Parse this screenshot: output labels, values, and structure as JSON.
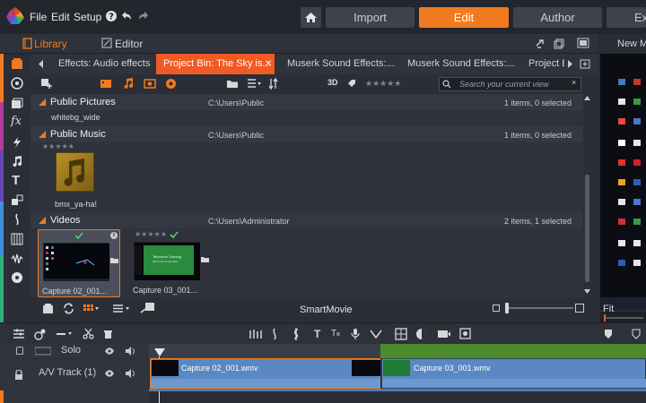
{
  "menu": {
    "file": "File",
    "edit": "Edit",
    "setup": "Setup"
  },
  "modes": {
    "import": "Import",
    "edit": "Edit",
    "author": "Author",
    "extra": "Ex"
  },
  "library": {
    "tab_library": "Library",
    "tab_editor": "Editor",
    "new_label": "New M"
  },
  "tabs": [
    {
      "label": "Effects: Audio effects"
    },
    {
      "label": "Project Bin: The Sky is..."
    },
    {
      "label": "Muserk Sound Effects:..."
    },
    {
      "label": "Muserk Sound Effects:..."
    },
    {
      "label": "Project B"
    }
  ],
  "toolbar": {
    "three_d": "3D",
    "search_placeholder": "Search your current view"
  },
  "groups": [
    {
      "name": "Public Pictures",
      "path": "C:\\Users\\Public",
      "count": "1 items, 0 selected",
      "items": [
        {
          "name": "whitebg_wide"
        }
      ]
    },
    {
      "name": "Public Music",
      "path": "C:\\Users\\Public",
      "count": "1 items, 0 selected",
      "items": [
        {
          "name": "bmx_ya-ha!"
        }
      ]
    },
    {
      "name": "Videos",
      "path": "C:\\Users\\Administrator",
      "count": "2 items, 1 selected",
      "items": [
        {
          "name": "Capture 02_001..."
        },
        {
          "name": "Capture 03_001..."
        }
      ]
    }
  ],
  "thumb_texts": {
    "training_title": "Technical Training",
    "training_sub": "Microsoft Corporation"
  },
  "library_bar": {
    "smartmovie": "SmartMovie"
  },
  "timeline": {
    "tracks": [
      {
        "label": "Solo"
      },
      {
        "label": "A/V Track (1)"
      }
    ],
    "clips": [
      {
        "name": "Capture 02_001.wmv"
      },
      {
        "name": "Capture 03_001.wmv"
      }
    ]
  },
  "right_panel": {
    "fit": "Fit"
  },
  "colors": {
    "accent": "#f07b1e",
    "active_tab": "#f05a24",
    "clip": "#5a88c2"
  }
}
